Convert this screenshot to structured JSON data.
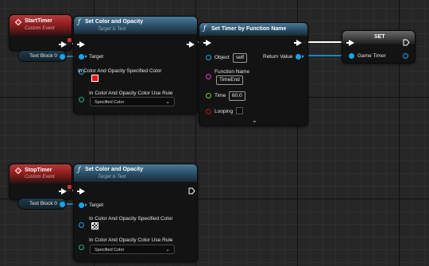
{
  "colors": {
    "exec_wire": "#ffffff",
    "object_wire": "#19a4e8",
    "event_header": "#8a1c1c",
    "function_header": "#2d5570",
    "color_swatch": "#ee1111"
  },
  "nodes": {
    "start_timer": {
      "title": "StartTimer",
      "subtitle": "Custom Event",
      "icon": "event-diamond-icon"
    },
    "set_color_1": {
      "title": "Set Color and Opacity",
      "subtitle": "Target is Text",
      "icon": "function-icon",
      "pins": {
        "target": "Target",
        "color": "In Color And Opacity Specified Color",
        "rule": "In Color And Opacity Color Use Rule"
      },
      "rule_value": "Specified Color"
    },
    "set_timer": {
      "title": "Set Timer by Function Name",
      "icon": "function-icon",
      "pins": {
        "object": "Object",
        "function_name": "Function Name",
        "time": "Time",
        "looping": "Looping",
        "return_value": "Return Value"
      },
      "object_value": "self",
      "function_name_value": "TimeEnd",
      "time_value": "60.0",
      "looping": false
    },
    "set_var": {
      "title": "SET",
      "pin_label": "Game Timer"
    },
    "text_block_1": {
      "label": "Text Block 0"
    },
    "stop_timer": {
      "title": "StopTimer",
      "subtitle": "Custom Event",
      "icon": "event-diamond-icon"
    },
    "set_color_2": {
      "title": "Set Color and Opacity",
      "subtitle": "Target is Text",
      "icon": "function-icon",
      "pins": {
        "target": "Target",
        "color": "In Color And Opacity Specified Color",
        "rule": "In Color And Opacity Color Use Rule"
      },
      "rule_value": "Specified Color"
    },
    "text_block_2": {
      "label": "Text Block 0"
    }
  }
}
